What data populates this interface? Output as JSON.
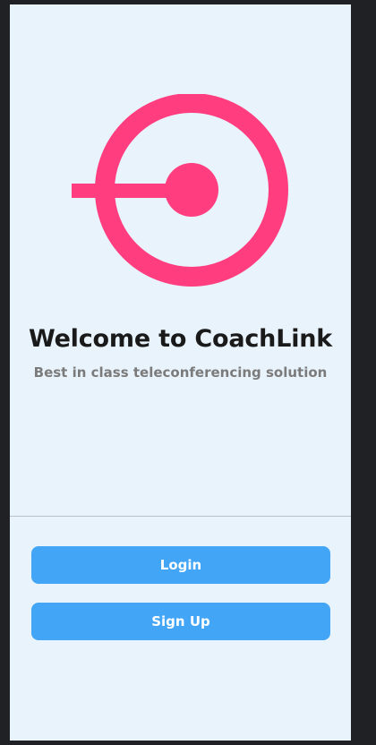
{
  "app": {
    "title": "Welcome to CoachLink",
    "subtitle": "Best in class teleconferencing solution"
  },
  "logo": {
    "icon": "coachlink-logo-icon",
    "color": "#ff3d7f"
  },
  "actions": {
    "login_label": "Login",
    "signup_label": "Sign Up",
    "button_color": "#42a5f5"
  }
}
